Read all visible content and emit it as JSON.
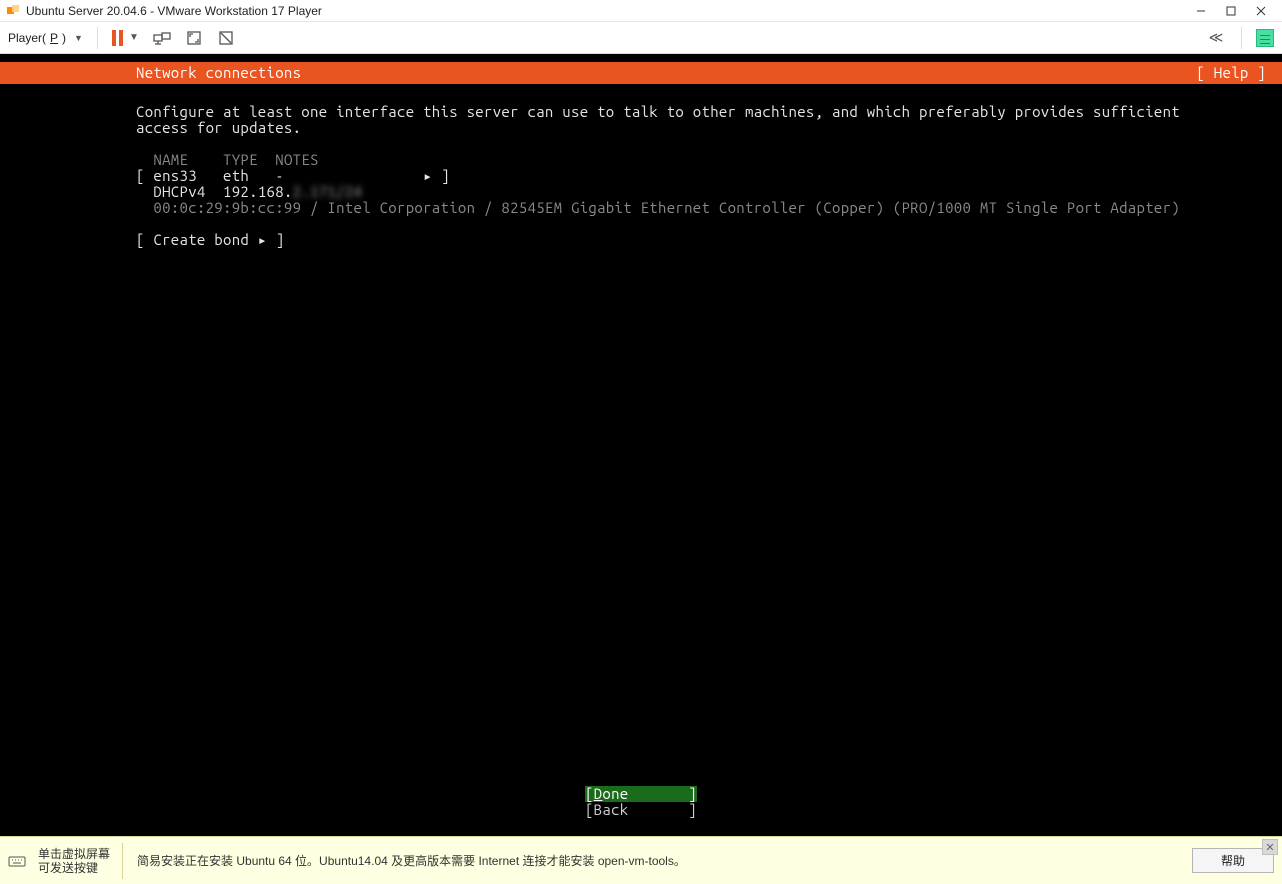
{
  "window": {
    "title": "Ubuntu Server 20.04.6 - VMware Workstation 17 Player"
  },
  "toolbar": {
    "player_label": "Player(",
    "player_key": "P",
    "player_label_end": ")"
  },
  "installer": {
    "header_title": "Network connections",
    "help_label": "[ Help ]",
    "intro": "Configure at least one interface this server can use to talk to other machines, and which preferably provides sufficient\naccess for updates.",
    "col_name": "NAME",
    "col_type": "TYPE",
    "col_notes": "NOTES",
    "iface_name": "ens33",
    "iface_type": "eth",
    "iface_notes": "-",
    "iface_arrow": "▸",
    "dhcp_label": "DHCPv4",
    "dhcp_ip_visible": "192.168.",
    "dhcp_ip_hidden": "2.171/24",
    "hw_line": "00:0c:29:9b:cc:99 / Intel Corporation / 82545EM Gigabit Ethernet Controller (Copper) (PRO/1000 MT Single Port Adapter)",
    "create_bond": "Create bond ▸",
    "done_initial": "D",
    "done_rest": "one",
    "back_label": "Back"
  },
  "infobar": {
    "hint_line1": "单击虚拟屏幕",
    "hint_line2": "可发送按键",
    "message": "简易安装正在安装 Ubuntu 64 位。Ubuntu14.04 及更高版本需要 Internet 连接才能安装 open-vm-tools。",
    "help_button": "帮助"
  }
}
